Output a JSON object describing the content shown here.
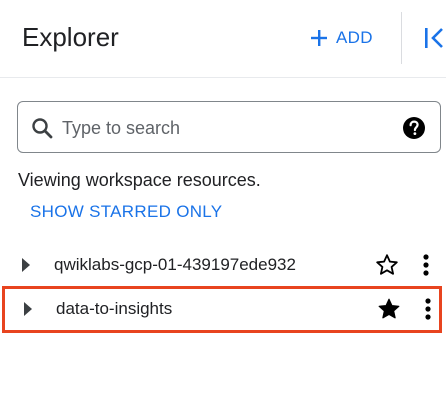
{
  "header": {
    "title": "Explorer",
    "add_label": "ADD"
  },
  "search": {
    "placeholder": "Type to search",
    "value": ""
  },
  "workspace": {
    "viewing_text": "Viewing workspace resources.",
    "show_starred_label": "SHOW STARRED ONLY"
  },
  "resources": [
    {
      "label": "qwiklabs-gcp-01-439197ede932",
      "starred": false,
      "expanded": false
    },
    {
      "label": "data-to-insights",
      "starred": true,
      "expanded": false,
      "highlighted": true
    }
  ],
  "colors": {
    "accent": "#1a73e8",
    "highlight_border": "#e8441f",
    "text": "#202124",
    "icon": "#3c4043"
  },
  "icons": {
    "add": "plus-icon",
    "collapse": "collapse-panel-icon",
    "search": "search-icon",
    "help": "help-icon",
    "expand": "triangle-right-icon",
    "star_empty": "star-outline-icon",
    "star_filled": "star-filled-icon",
    "more": "more-vert-icon"
  }
}
